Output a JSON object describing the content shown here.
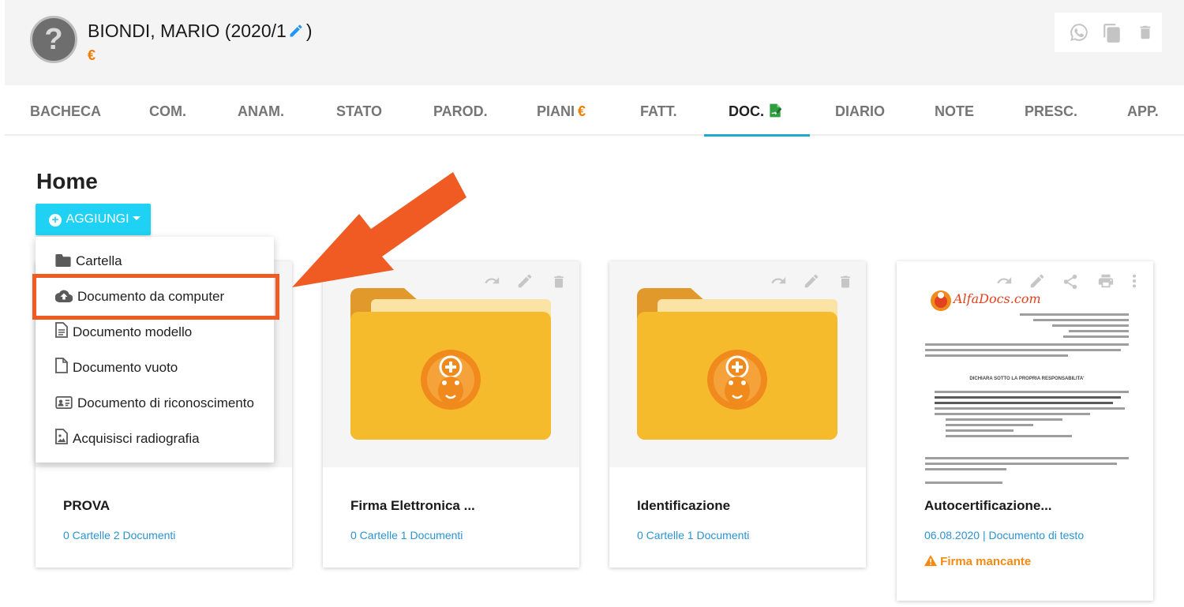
{
  "header": {
    "patient_name": "BIONDI, MARIO (2020/1",
    "patient_name_close": ")",
    "currency_symbol": "€",
    "avatar_symbol": "?"
  },
  "tabs": [
    {
      "label": "BACHECA"
    },
    {
      "label": "COM."
    },
    {
      "label": "ANAM."
    },
    {
      "label": "STATO"
    },
    {
      "label": "PAROD."
    },
    {
      "label": "PIANI",
      "suffix": "€"
    },
    {
      "label": "FATT."
    },
    {
      "label": "DOC.",
      "active": true
    },
    {
      "label": "DIARIO"
    },
    {
      "label": "NOTE"
    },
    {
      "label": "PRESC."
    },
    {
      "label": "APP."
    }
  ],
  "main": {
    "title": "Home",
    "add_button": "AGGIUNGI"
  },
  "add_menu": {
    "items": [
      {
        "label": "Cartella",
        "icon": "folder-icon"
      },
      {
        "label": "Documento da computer",
        "icon": "cloud-upload-icon"
      },
      {
        "label": "Documento modello",
        "icon": "document-template-icon"
      },
      {
        "label": "Documento vuoto",
        "icon": "blank-document-icon"
      },
      {
        "label": "Documento di riconoscimento",
        "icon": "id-card-icon"
      },
      {
        "label": "Acquisisci radiografia",
        "icon": "xray-image-icon"
      }
    ]
  },
  "cards": [
    {
      "title": "PROVA",
      "subtitle": "0 Cartelle 2 Documenti",
      "type": "folder"
    },
    {
      "title": "Firma Elettronica ...",
      "subtitle": "0 Cartelle 1 Documenti",
      "type": "folder"
    },
    {
      "title": "Identificazione",
      "subtitle": "0 Cartelle 1 Documenti",
      "type": "folder"
    },
    {
      "title": "Autocertificazione...",
      "subtitle": "06.08.2020 | Documento di testo",
      "warning": "Firma mancante",
      "type": "document"
    }
  ],
  "doc_preview": {
    "logo_text": "AlfaDocs.com",
    "heading": "DICHIARA SOTTO LA PROPRIA RESPONSABILITA'"
  },
  "colors": {
    "accent_cyan": "#1fd1f2",
    "tab_underline": "#22a7d3",
    "annotation_orange": "#f05a23",
    "folder_yellow": "#f5b82e",
    "link_blue": "#2b93d1",
    "warning_orange": "#f28a14"
  }
}
